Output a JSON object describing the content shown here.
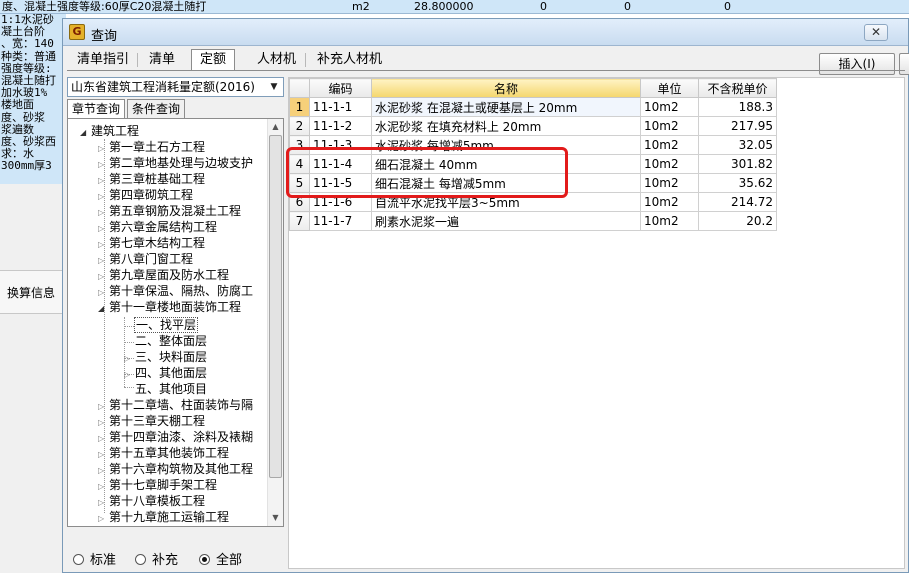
{
  "background": {
    "top_row": {
      "text": "度、混凝土强度等级:60厚C20混凝土随打",
      "unit": "m2",
      "qty": "28.800000",
      "v1": "0",
      "v2": "0",
      "v3": "0"
    },
    "side_lines": [
      "1:1水泥砂",
      "凝土台阶",
      "、宽：140",
      "种类：普通",
      "强度等级:",
      "混凝土随打",
      "加水玻1%",
      "",
      "楼地面",
      "度、砂浆",
      "浆遍数",
      "度、砂浆西",
      "求：水",
      "300mm厚3"
    ],
    "calc_tab": "换算信息"
  },
  "dialog": {
    "title": "查询",
    "close_glyph": "✕",
    "tabs": [
      "清单指引",
      "清单",
      "定额",
      "人材机",
      "补充人材机"
    ],
    "active_tab": "定额",
    "insert_button": "插入(I)",
    "quota_library": "山东省建筑工程消耗量定额(2016)",
    "subtabs": [
      "章节查询",
      "条件查询"
    ],
    "tree": {
      "root": "建筑工程",
      "chapters": [
        "第一章土石方工程",
        "第二章地基处理与边坡支护",
        "第三章桩基础工程",
        "第四章砌筑工程",
        "第五章钢筋及混凝土工程",
        "第六章金属结构工程",
        "第七章木结构工程",
        "第八章门窗工程",
        "第九章屋面及防水工程",
        "第十章保温、隔热、防腐工",
        "第十一章楼地面装饰工程"
      ],
      "sections": [
        "一、找平层",
        "二、整体面层",
        "三、块料面层",
        "四、其他面层",
        "五、其他项目"
      ],
      "chapters_after": [
        "第十二章墙、柱面装饰与隔",
        "第十三章天棚工程",
        "第十四章油漆、涂料及裱糊",
        "第十五章其他装饰工程",
        "第十六章构筑物及其他工程",
        "第十七章脚手架工程",
        "第十八章模板工程",
        "第十九章施工运输工程"
      ]
    },
    "filters": [
      "标准",
      "补充",
      "全部"
    ],
    "selected_filter": "全部",
    "grid": {
      "columns": [
        "",
        "编码",
        "名称",
        "单位",
        "不含税单价"
      ],
      "rows": [
        {
          "no": "1",
          "code": "11-1-1",
          "name": "水泥砂浆 在混凝土或硬基层上 20mm",
          "unit": "10m2",
          "price": "188.3"
        },
        {
          "no": "2",
          "code": "11-1-2",
          "name": "水泥砂浆 在填充材料上 20mm",
          "unit": "10m2",
          "price": "217.95"
        },
        {
          "no": "3",
          "code": "11-1-3",
          "name": "水泥砂浆 每增减5mm",
          "unit": "10m2",
          "price": "32.05"
        },
        {
          "no": "4",
          "code": "11-1-4",
          "name": "细石混凝土 40mm",
          "unit": "10m2",
          "price": "301.82"
        },
        {
          "no": "5",
          "code": "11-1-5",
          "name": "细石混凝土 每增减5mm",
          "unit": "10m2",
          "price": "35.62"
        },
        {
          "no": "6",
          "code": "11-1-6",
          "name": "自流平水泥找平层3~5mm",
          "unit": "10m2",
          "price": "214.72"
        },
        {
          "no": "7",
          "code": "11-1-7",
          "name": "刷素水泥浆一遍",
          "unit": "10m2",
          "price": "20.2"
        }
      ]
    },
    "highlight_color": "#e21b1b"
  }
}
